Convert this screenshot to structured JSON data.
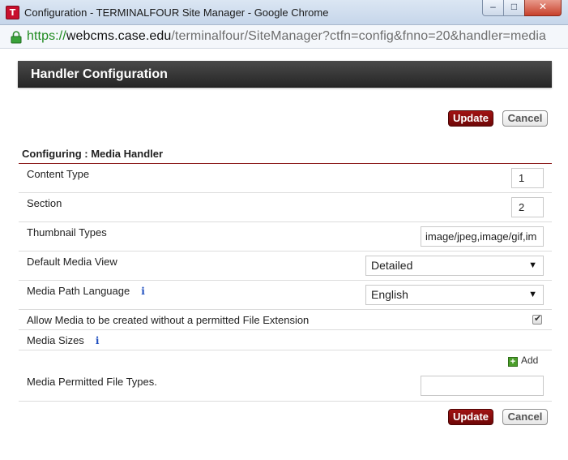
{
  "window": {
    "app_icon_letter": "T",
    "title": "Configuration - TERMINALFOUR Site Manager - Google Chrome",
    "controls": {
      "minimize": "–",
      "maximize": "□",
      "close": "✕"
    }
  },
  "address_bar": {
    "scheme": "https://",
    "host": "webcms.case.edu",
    "path": "/terminalfour/SiteManager?ctfn=config&fnno=20&handler=media"
  },
  "page": {
    "header_title": "Handler Configuration",
    "update_label": "Update",
    "cancel_label": "Cancel",
    "section_title": "Configuring : Media Handler",
    "fields": {
      "content_type": {
        "label": "Content Type",
        "value": "1"
      },
      "section": {
        "label": "Section",
        "value": "2"
      },
      "thumbnail_types": {
        "label": "Thumbnail Types",
        "value": "image/jpeg,image/gif,im"
      },
      "default_media_view": {
        "label": "Default Media View",
        "selected": "Detailed"
      },
      "media_path_language": {
        "label": "Media Path Language",
        "selected": "English",
        "info_icon": "i"
      },
      "allow_media_without_extension": {
        "label": "Allow Media to be created without a permitted File Extension",
        "checked": true
      },
      "media_sizes": {
        "label": "Media Sizes",
        "info_icon": "i",
        "add_label": "Add"
      },
      "media_permitted_file_types": {
        "label": "Media Permitted File Types.",
        "value": ""
      }
    },
    "select_arrow": "▼",
    "checkbox_tick": "✔",
    "plus_glyph": "+"
  },
  "colors": {
    "update_button": "#8b0e0e",
    "header_bar": "#333333",
    "section_rule": "#8b1a1a",
    "https_green": "#1e8a1e",
    "info_icon": "#1f4fbf"
  }
}
